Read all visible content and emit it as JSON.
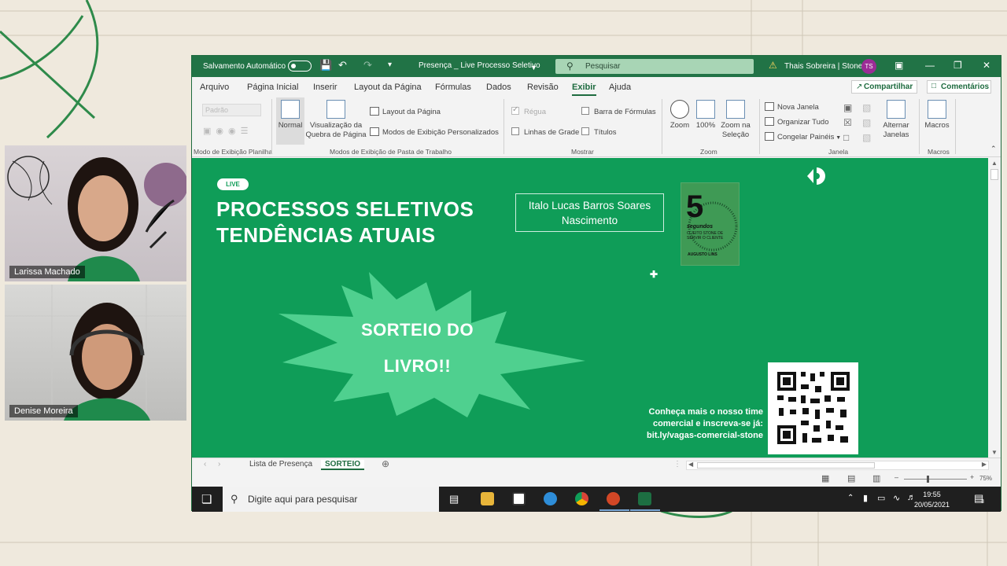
{
  "participants": [
    {
      "name": "Larissa Machado"
    },
    {
      "name": "Denise Moreira"
    }
  ],
  "excel": {
    "autosave_label": "Salvamento Automático",
    "doc_title": "Presença _ Live Processo Seletivo",
    "search_placeholder": "Pesquisar",
    "user_name": "Thais Sobreira | Stone",
    "user_initials": "TS",
    "menu": [
      "Arquivo",
      "Página Inicial",
      "Inserir",
      "Layout da Página",
      "Fórmulas",
      "Dados",
      "Revisão",
      "Exibir",
      "Ajuda"
    ],
    "active_menu": "Exibir",
    "share_label": "Compartilhar",
    "comments_label": "Comentários",
    "ribbon": {
      "sheet_view_dropdown": "Padrão",
      "sheet_view_group": "Modo de Exibição Planilha",
      "normal_label": "Normal",
      "page_break_label": "Visualização da Quebra de Página",
      "page_layout_label": "Layout da Página",
      "custom_views_label": "Modos de Exibição Personalizados",
      "workbook_views_group": "Modos de Exibição de Pasta de Trabalho",
      "ruler_label": "Régua",
      "formula_bar_label": "Barra de Fórmulas",
      "gridlines_label": "Linhas de Grade",
      "headings_label": "Títulos",
      "show_group": "Mostrar",
      "zoom_label": "Zoom",
      "zoom100_label": "100%",
      "zoom_selection_label": "Zoom na Seleção",
      "zoom_group": "Zoom",
      "new_window_label": "Nova Janela",
      "arrange_all_label": "Organizar Tudo",
      "freeze_panes_label": "Congelar Painéis",
      "switch_windows_label": "Alternar Janelas",
      "window_group": "Janela",
      "macros_label": "Macros",
      "macros_group": "Macros"
    },
    "slide": {
      "live_tag": "LIVE",
      "headline_line1": "PROCESSOS SELETIVOS",
      "headline_line2": "TENDÊNCIAS ATUAIS",
      "speaker_line1": "Italo Lucas Barros Soares",
      "speaker_line2": "Nascimento",
      "book_number": "5",
      "book_subtitle": "segundos",
      "book_tagline": "O JEITO STONE DE SERVIR O CLIENTE",
      "book_author": "AUGUSTO LINS",
      "burst_line1": "SORTEIO DO",
      "burst_line2": "LIVRO!!",
      "cta_line1": "Conheça mais o nosso time",
      "cta_line2": "comercial e inscreva-se já:",
      "cta_link": "bit.ly/vagas-comercial-stone"
    },
    "sheet_tabs": [
      "Lista de Presença",
      "SORTEIO"
    ],
    "active_sheet": "SORTEIO",
    "zoom_level": "75%"
  },
  "taskbar": {
    "search_placeholder": "Digite aqui para pesquisar",
    "time": "19:55",
    "date": "20/05/2021",
    "notification_count": "3"
  },
  "colors": {
    "excel_green": "#217346",
    "slide_green": "#0f9d58",
    "burst_green": "#4fd08f"
  }
}
